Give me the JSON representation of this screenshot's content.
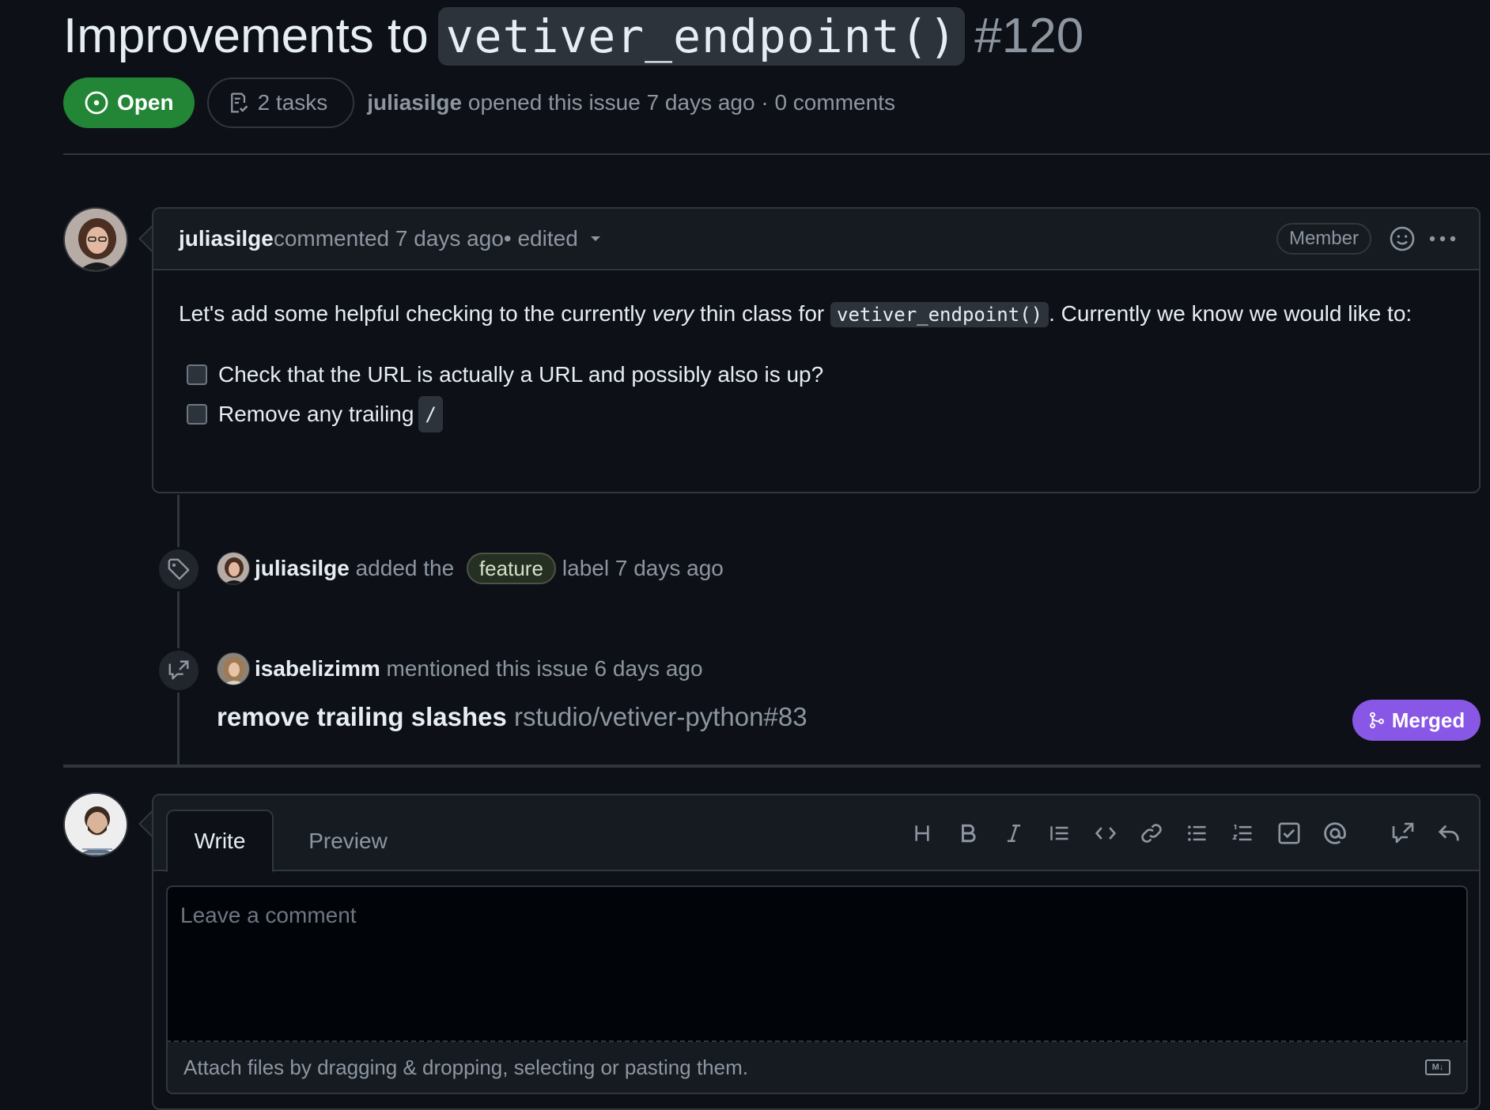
{
  "issue": {
    "title_prefix": "Improvements to ",
    "title_code": "vetiver_endpoint()",
    "number": "#120",
    "state": "Open",
    "tasks": "2 tasks",
    "author": "juliasilge",
    "opened_text": " opened this issue 7 days ago · 0 comments"
  },
  "comment": {
    "author": "juliasilge",
    "meta": " commented 7 days ago",
    "edited": " • edited",
    "role": "Member",
    "body_part1": "Let's add some helpful checking to the currently ",
    "body_em": "very",
    "body_part2": " thin class for ",
    "body_code": "vetiver_endpoint()",
    "body_part3": ". Currently we know we would like to:",
    "tasks": [
      {
        "text": "Check that the URL is actually a URL and possibly also is up?"
      },
      {
        "text": "Remove any trailing ",
        "code": "/"
      }
    ]
  },
  "timeline": {
    "label_event": {
      "actor": "juliasilge",
      "before": " added the ",
      "label": "feature",
      "after": " label 7 days ago"
    },
    "mention_event": {
      "actor": "isabelizimm",
      "text": " mentioned this issue 6 days ago",
      "pr_title": "remove trailing slashes",
      "pr_ref": " rstudio/vetiver-python#83",
      "pr_state": "Merged"
    }
  },
  "editor": {
    "tabs": [
      "Write",
      "Preview"
    ],
    "placeholder": "Leave a comment",
    "attach_text": "Attach files by dragging & dropping, selecting or pasting them.",
    "toolbar": [
      "heading-icon",
      "bold-icon",
      "italic-icon",
      "quote-icon",
      "code-icon",
      "link-icon",
      "bulleted-list-icon",
      "numbered-list-icon",
      "task-list-icon",
      "mention-icon",
      "reference-icon",
      "reply-icon"
    ]
  },
  "colors": {
    "open": "#238636",
    "merged": "#8957e5",
    "background": "#0d1117"
  }
}
